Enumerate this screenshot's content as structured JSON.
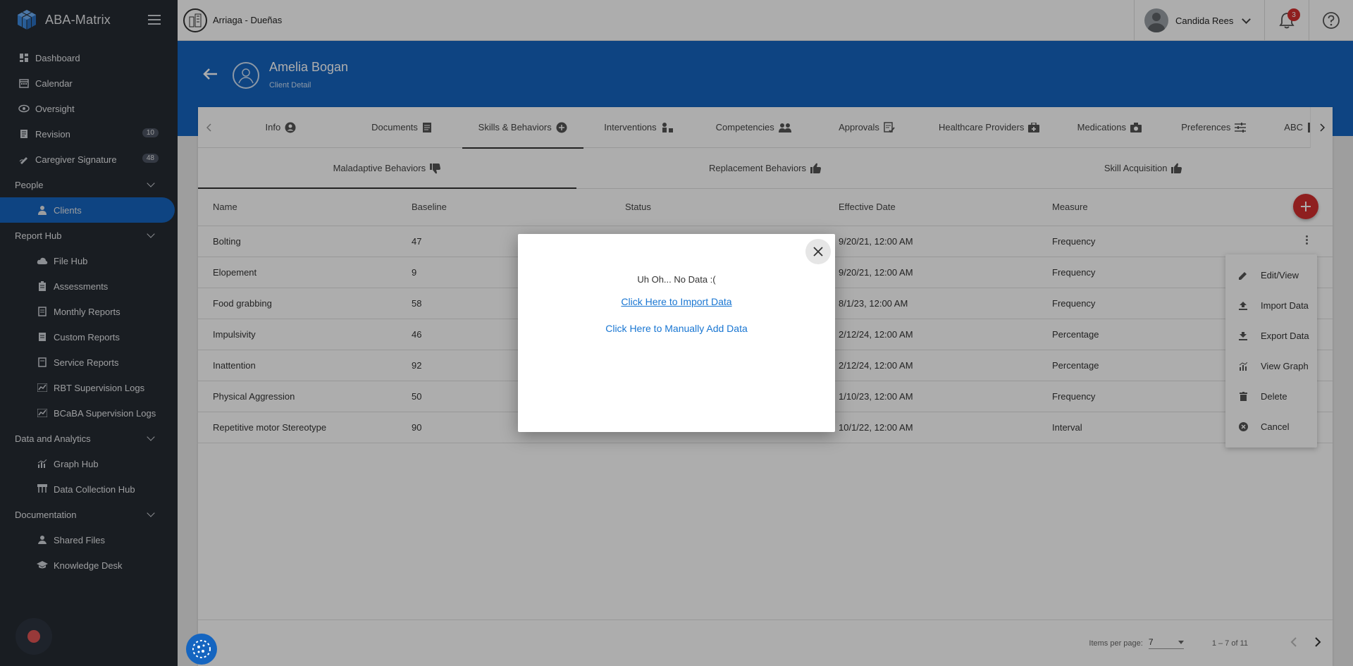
{
  "app": {
    "name": "ABA-Matrix"
  },
  "sidebar": {
    "items": [
      {
        "label": "Dashboard",
        "icon": "dashboard-icon"
      },
      {
        "label": "Calendar",
        "icon": "calendar-icon"
      },
      {
        "label": "Oversight",
        "icon": "eye-icon"
      },
      {
        "label": "Revision",
        "icon": "document-icon",
        "badge": "10"
      },
      {
        "label": "Caregiver Signature",
        "icon": "signature-icon",
        "badge": "48"
      }
    ],
    "sections": [
      {
        "label": "People",
        "items": [
          {
            "label": "Clients",
            "icon": "person-icon",
            "active": true
          }
        ]
      },
      {
        "label": "Report Hub",
        "items": [
          {
            "label": "File Hub",
            "icon": "cloud-icon"
          },
          {
            "label": "Assessments",
            "icon": "clipboard-icon"
          },
          {
            "label": "Monthly Reports",
            "icon": "report-icon"
          },
          {
            "label": "Custom Reports",
            "icon": "report-icon"
          },
          {
            "label": "Service Reports",
            "icon": "report-icon"
          },
          {
            "label": "RBT Supervision Logs",
            "icon": "chart-icon"
          },
          {
            "label": "BCaBA Supervision Logs",
            "icon": "chart-icon"
          }
        ]
      },
      {
        "label": "Data and Analytics",
        "items": [
          {
            "label": "Graph Hub",
            "icon": "graph-icon"
          },
          {
            "label": "Data Collection Hub",
            "icon": "hierarchy-icon"
          }
        ]
      },
      {
        "label": "Documentation",
        "items": [
          {
            "label": "Shared Files",
            "icon": "shared-files-icon"
          },
          {
            "label": "Knowledge Desk",
            "icon": "graduation-cap-icon"
          }
        ]
      }
    ]
  },
  "topbar": {
    "org_name": "Arriaga - Dueñas",
    "user_name": "Candida Rees",
    "notification_count": "3"
  },
  "header": {
    "client_name": "Amelia Bogan",
    "subtitle": "Client Detail"
  },
  "tabs": [
    {
      "label": "Info",
      "icon": "account-circle-icon"
    },
    {
      "label": "Documents",
      "icon": "document-icon"
    },
    {
      "label": "Skills & Behaviors",
      "icon": "puzzle-icon",
      "active": true
    },
    {
      "label": "Interventions",
      "icon": "interventions-icon"
    },
    {
      "label": "Competencies",
      "icon": "group-icon"
    },
    {
      "label": "Approvals",
      "icon": "approval-icon"
    },
    {
      "label": "Healthcare Providers",
      "icon": "medical-bag-icon"
    },
    {
      "label": "Medications",
      "icon": "camera-icon"
    },
    {
      "label": "Preferences",
      "icon": "sliders-icon"
    },
    {
      "label": "ABC",
      "icon": "document-icon"
    }
  ],
  "subtabs": [
    {
      "label": "Maladaptive Behaviors",
      "icon": "thumbs-down-icon",
      "active": true
    },
    {
      "label": "Replacement Behaviors",
      "icon": "thumbs-up-icon"
    },
    {
      "label": "Skill Acquisition",
      "icon": "thumbs-up-icon"
    }
  ],
  "table": {
    "columns": [
      "Name",
      "Baseline",
      "Status",
      "Effective Date",
      "Measure"
    ],
    "rows": [
      [
        "Bolting",
        "47",
        "",
        "9/20/21, 12:00 AM",
        "Frequency"
      ],
      [
        "Elopement",
        "9",
        "",
        "9/20/21, 12:00 AM",
        "Frequency"
      ],
      [
        "Food grabbing",
        "58",
        "",
        "8/1/23, 12:00 AM",
        "Frequency"
      ],
      [
        "Impulsivity",
        "46",
        "",
        "2/12/24, 12:00 AM",
        "Percentage"
      ],
      [
        "Inattention",
        "92",
        "",
        "2/12/24, 12:00 AM",
        "Percentage"
      ],
      [
        "Physical Aggression",
        "50",
        "",
        "1/10/23, 12:00 AM",
        "Frequency"
      ],
      [
        "Repetitive motor Stereotype",
        "90",
        "",
        "10/1/22, 12:00 AM",
        "Interval"
      ]
    ]
  },
  "pager": {
    "items_per_page_label": "Items per page:",
    "items_per_page": "7",
    "range": "1 – 7 of 11"
  },
  "context_menu": [
    {
      "label": "Edit/View",
      "icon": "pencil-icon"
    },
    {
      "label": "Import Data",
      "icon": "upload-icon"
    },
    {
      "label": "Export Data",
      "icon": "download-icon"
    },
    {
      "label": "View Graph",
      "icon": "graph-icon"
    },
    {
      "label": "Delete",
      "icon": "trash-icon"
    },
    {
      "label": "Cancel",
      "icon": "cancel-icon"
    }
  ],
  "modal": {
    "message": "Uh Oh... No Data :(",
    "import_link": "Click Here to Import Data",
    "manual_link": "Click Here to Manually Add Data"
  }
}
